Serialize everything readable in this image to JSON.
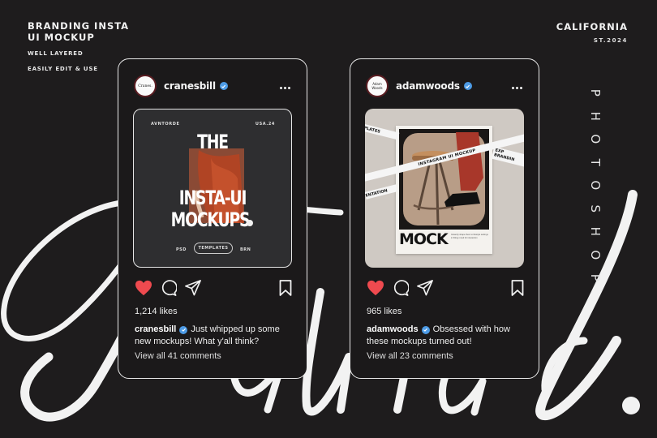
{
  "brand": {
    "title_line1": "BRANDING INSTA",
    "title_line2": "UI MOCKUP",
    "sub_line1": "WELL LAYERED",
    "sub_line2": "EASILY EDIT & USE",
    "city": "CALIFORNIA",
    "established": "ST.2024",
    "vertical_word": [
      "P",
      "H",
      "O",
      "T",
      "O",
      "S",
      "H",
      "O",
      "P"
    ],
    "script_word": "Jaura."
  },
  "colors": {
    "background": "#1e1c1d",
    "card": "#1b191a",
    "like_red": "#ef4a4f",
    "verified_blue": "#4d9be6",
    "avatar_ring": "#5a1d22"
  },
  "posts": [
    {
      "avatar_text": "Cranes.",
      "username": "cranesbill",
      "verified": true,
      "media": {
        "top_left": "AVNTORDE",
        "top_right": "USA.24",
        "headline_1": "THE",
        "headline_2": "INSTA-UI",
        "headline_3": "MOCKUPS",
        "tag_left": "PSD",
        "tag_center": "TEMPLATES",
        "tag_right": "BRN"
      },
      "liked": true,
      "likes": "1,214 likes",
      "caption_user": "cranesbill",
      "caption_text": "Just whipped up some new mockups! What y'all think?",
      "comments": "View all 41 comments"
    },
    {
      "avatar_text": "Adam Woods",
      "username": "adamwoods",
      "verified": true,
      "media": {
        "tape_1": "INSTAGRAM UI MOCKUP",
        "tape_2": "PLATES",
        "tape_3": "ENTATION",
        "tape_4a": "EXP",
        "tape_4b": "BRANDIN",
        "poster_title": "MOCK",
        "poster_body": "Instantly shape them to lifestyle settings in fitting mood for interaction"
      },
      "liked": true,
      "likes": "965 likes",
      "caption_user": "adamwoods",
      "caption_text": "Obsessed with how these mockups turned out!",
      "comments": "View all 23 comments"
    }
  ]
}
